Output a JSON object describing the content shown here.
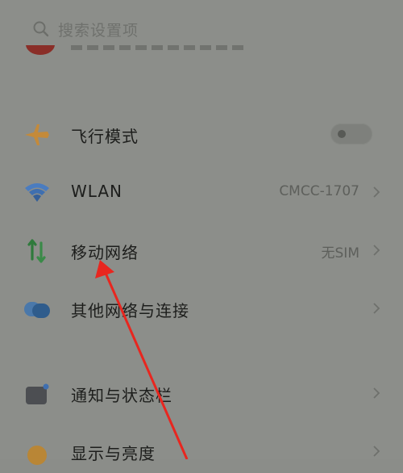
{
  "search": {
    "placeholder": "搜索设置项"
  },
  "settings": {
    "items": [
      {
        "label": "飞行模式",
        "value": "",
        "icon": "airplane-icon",
        "control": "toggle",
        "toggle_on": false
      },
      {
        "label": "WLAN",
        "value": "CMCC-1707",
        "icon": "wifi-icon",
        "control": "chevron"
      },
      {
        "label": "移动网络",
        "value": "无SIM",
        "icon": "mobile-data-icon",
        "control": "chevron"
      },
      {
        "label": "其他网络与连接",
        "value": "",
        "icon": "network-connections-icon",
        "control": "chevron"
      },
      {
        "label": "通知与状态栏",
        "value": "",
        "icon": "notification-icon",
        "control": "chevron"
      },
      {
        "label": "显示与亮度",
        "value": "",
        "icon": "display-brightness-icon",
        "control": "chevron"
      }
    ]
  },
  "colors": {
    "overlay_bg": "#8c8e8a",
    "airplane": "#c48a3a",
    "wifi": "#3f6fb0",
    "mobile_green": "#2f7a3c",
    "connections": "#3d6c9e",
    "annotation_arrow": "#e8261f"
  }
}
